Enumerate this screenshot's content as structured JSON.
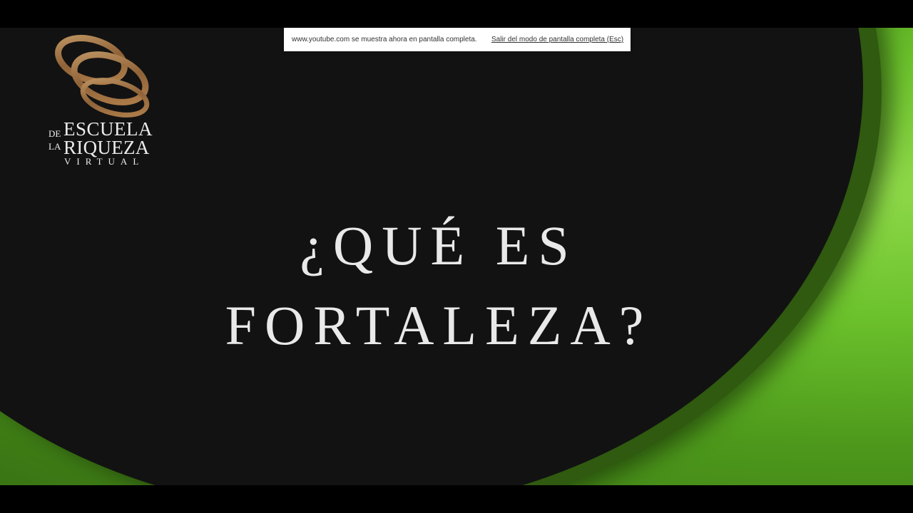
{
  "fullscreen_notice": {
    "message": "www.youtube.com se muestra ahora en pantalla completa.",
    "exit_link": "Salir del modo de pantalla completa (Esc)"
  },
  "logo": {
    "de": "DE",
    "la": "LA",
    "line1": "ESCUELA",
    "line2": "RIQUEZA",
    "line3": "VIRTUAL",
    "ring_color": "#a8794a"
  },
  "title": {
    "line1": "¿QUÉ ES",
    "line2": "FORTALEZA?"
  },
  "colors": {
    "background": "#121212",
    "accent_green": "#6cc22c",
    "title_text": "#e9e9e9"
  }
}
